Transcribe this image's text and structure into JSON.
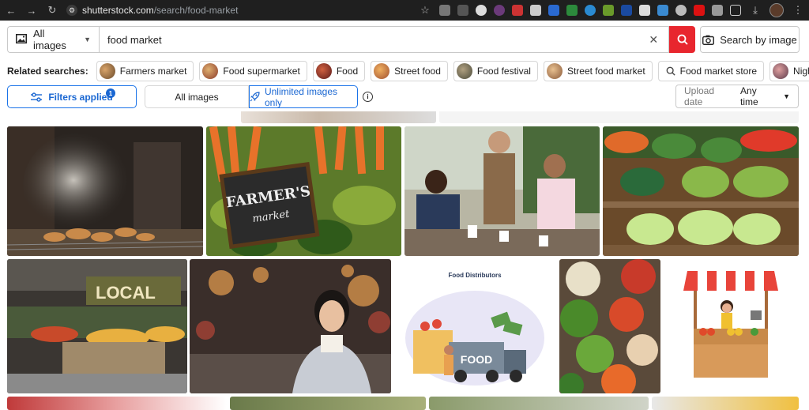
{
  "browser": {
    "domain": "shutterstock.com",
    "path": "/search/food-market"
  },
  "search": {
    "asset_type": "All images",
    "query": "food market",
    "by_image_label": "Search by image"
  },
  "related": {
    "label": "Related searches:",
    "items": [
      {
        "label": "Farmers market",
        "color": "#8a6a4a"
      },
      {
        "label": "Food supermarket",
        "color": "#a55a3a"
      },
      {
        "label": "Food",
        "color": "#9b3a2a"
      },
      {
        "label": "Street food",
        "color": "#c47a3a"
      },
      {
        "label": "Food festival",
        "color": "#6a6a5a"
      },
      {
        "label": "Street food market",
        "color": "#b07a4a"
      },
      {
        "label": "Food market store",
        "color": ""
      },
      {
        "label": "Night market",
        "color": "#7a5a5a"
      }
    ]
  },
  "filters": {
    "filters_applied_label": "Filters applied",
    "filters_count": "1",
    "toggle_all": "All images",
    "toggle_unlimited": "Unlimited images only",
    "upload_label": "Upload date",
    "upload_value": "Any time"
  },
  "grid": {
    "row1": [
      {
        "name": "grill-smoke-photo"
      },
      {
        "name": "farmers-market-sign-photo",
        "text_line1": "FARMER'S",
        "text_line2": "market"
      },
      {
        "name": "outdoor-dining-photo"
      },
      {
        "name": "vegetable-stall-photo"
      }
    ],
    "row2": [
      {
        "name": "grocery-store-photo",
        "sign": "LOCAL"
      },
      {
        "name": "woman-eating-night-market-photo"
      },
      {
        "name": "food-distributors-illustration",
        "title": "Food Distributors",
        "truck_label": "FOOD"
      },
      {
        "name": "peppers-baskets-photo"
      },
      {
        "name": "market-stall-illustration"
      }
    ]
  },
  "colors": {
    "accent": "#1a67d2",
    "search_red": "#e8262e"
  }
}
